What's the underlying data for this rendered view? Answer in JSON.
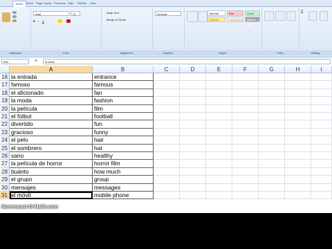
{
  "ribbon": {
    "tabs": [
      "Home",
      "Insert",
      "Page Layout",
      "Formulas",
      "Data",
      "Review",
      "View"
    ],
    "font_name": "Arial",
    "font_size": "10",
    "wrap_text": "Wrap Text",
    "merge_center": "Merge & Center",
    "number_format": "General",
    "styles": [
      "Normal",
      "Bad",
      "Good",
      "Neutral",
      "Calculation",
      "Check Cell"
    ],
    "groups": [
      "Clipboard",
      "Font",
      "Alignment",
      "Number",
      "Styles",
      "Cells",
      "Editing"
    ]
  },
  "formula_bar": {
    "name_box": "A31",
    "fx": "fx",
    "value": "el móvil"
  },
  "columns": [
    "A",
    "B",
    "C",
    "D",
    "E",
    "F",
    "G",
    "H",
    "I"
  ],
  "rows": [
    {
      "n": "16",
      "a": "la entrada",
      "b": "entrance"
    },
    {
      "n": "17",
      "a": "famoso",
      "b": "famous"
    },
    {
      "n": "18",
      "a": "el aficionado",
      "b": "fan"
    },
    {
      "n": "19",
      "a": "la moda",
      "b": "fashion"
    },
    {
      "n": "20",
      "a": "la película",
      "b": "film"
    },
    {
      "n": "21",
      "a": "el fútbol",
      "b": "football"
    },
    {
      "n": "22",
      "a": "divertido",
      "b": "fun"
    },
    {
      "n": "23",
      "a": "gracioso",
      "b": "funny"
    },
    {
      "n": "24",
      "a": "el pelo",
      "b": "hair"
    },
    {
      "n": "25",
      "a": "el sombrero",
      "b": "hat"
    },
    {
      "n": "26",
      "a": "sano",
      "b": "healthy"
    },
    {
      "n": "27",
      "a": "la película de horror",
      "b": "horror film"
    },
    {
      "n": "28",
      "a": "buánto",
      "b": "how much"
    },
    {
      "n": "29",
      "a": "el grupo",
      "b": "group"
    },
    {
      "n": "30",
      "a": "mensajes",
      "b": "messages"
    },
    {
      "n": "31",
      "a": "el móvil",
      "b": "mobile phone"
    }
  ],
  "active_row": "31",
  "active_column": "A",
  "watermark": "Screencast-O-Matic.com",
  "colors": {
    "selected_header": "#f9d99f",
    "ribbon": "#dfe9f5"
  }
}
